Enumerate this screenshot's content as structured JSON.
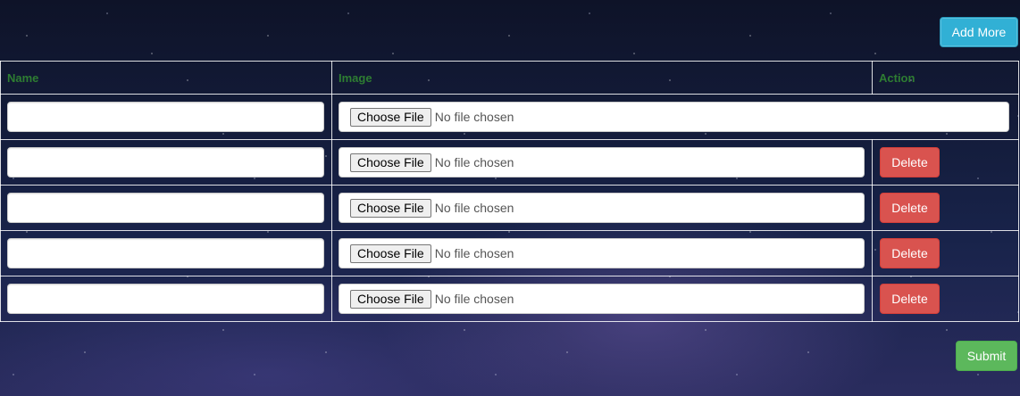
{
  "toolbar": {
    "add_more_label": "Add More"
  },
  "table": {
    "headers": {
      "name": "Name",
      "image": "Image",
      "action": "Action"
    },
    "rows": [
      {
        "name_value": "",
        "file_button": "Choose File",
        "file_status": "No file chosen"
      },
      {
        "name_value": "",
        "file_button": "Choose File",
        "file_status": "No file chosen",
        "delete_label": "Delete"
      },
      {
        "name_value": "",
        "file_button": "Choose File",
        "file_status": "No file chosen",
        "delete_label": "Delete"
      },
      {
        "name_value": "",
        "file_button": "Choose File",
        "file_status": "No file chosen",
        "delete_label": "Delete"
      },
      {
        "name_value": "",
        "file_button": "Choose File",
        "file_status": "No file chosen",
        "delete_label": "Delete"
      }
    ]
  },
  "footer": {
    "submit_label": "Submit"
  },
  "colors": {
    "header_text": "#2e7d32",
    "add_more_bg": "#31b0d5",
    "delete_bg": "#d9534f",
    "submit_bg": "#5cb85c"
  }
}
